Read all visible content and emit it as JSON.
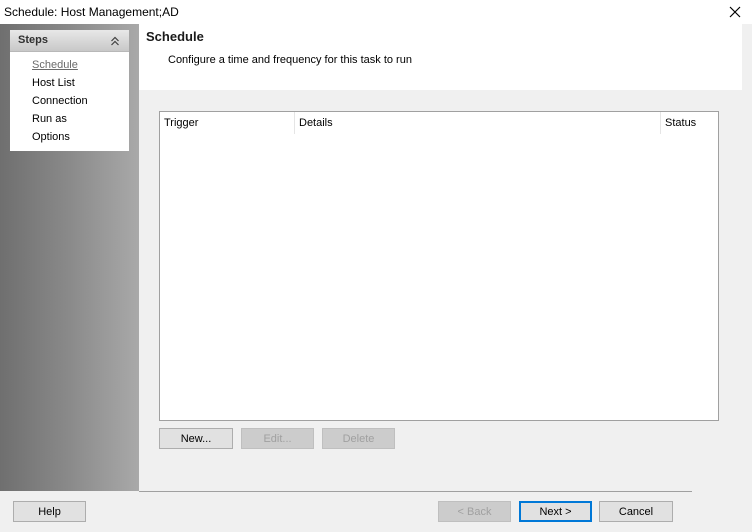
{
  "window": {
    "title": "Schedule: Host Management;AD",
    "close_icon": "close-icon"
  },
  "steps": {
    "header": "Steps",
    "collapse_icon": "double-chevron-up-icon",
    "items": [
      {
        "label": "Schedule",
        "active": true
      },
      {
        "label": "Host List",
        "active": false
      },
      {
        "label": "Connection",
        "active": false
      },
      {
        "label": "Run as",
        "active": false
      },
      {
        "label": "Options",
        "active": false
      }
    ]
  },
  "page": {
    "title": "Schedule",
    "subtitle": "Configure a time and frequency for this task to run"
  },
  "table": {
    "columns": [
      "Trigger",
      "Details",
      "Status"
    ],
    "rows": []
  },
  "table_actions": {
    "new": "New...",
    "edit": "Edit...",
    "delete": "Delete"
  },
  "footer": {
    "help": "Help",
    "back": "< Back",
    "next": "Next >",
    "cancel": "Cancel"
  },
  "colors": {
    "default_button_border": "#0078d7",
    "sidebar_gradient_dark": "#6f6f6f",
    "sidebar_gradient_light": "#a9a9a9"
  }
}
